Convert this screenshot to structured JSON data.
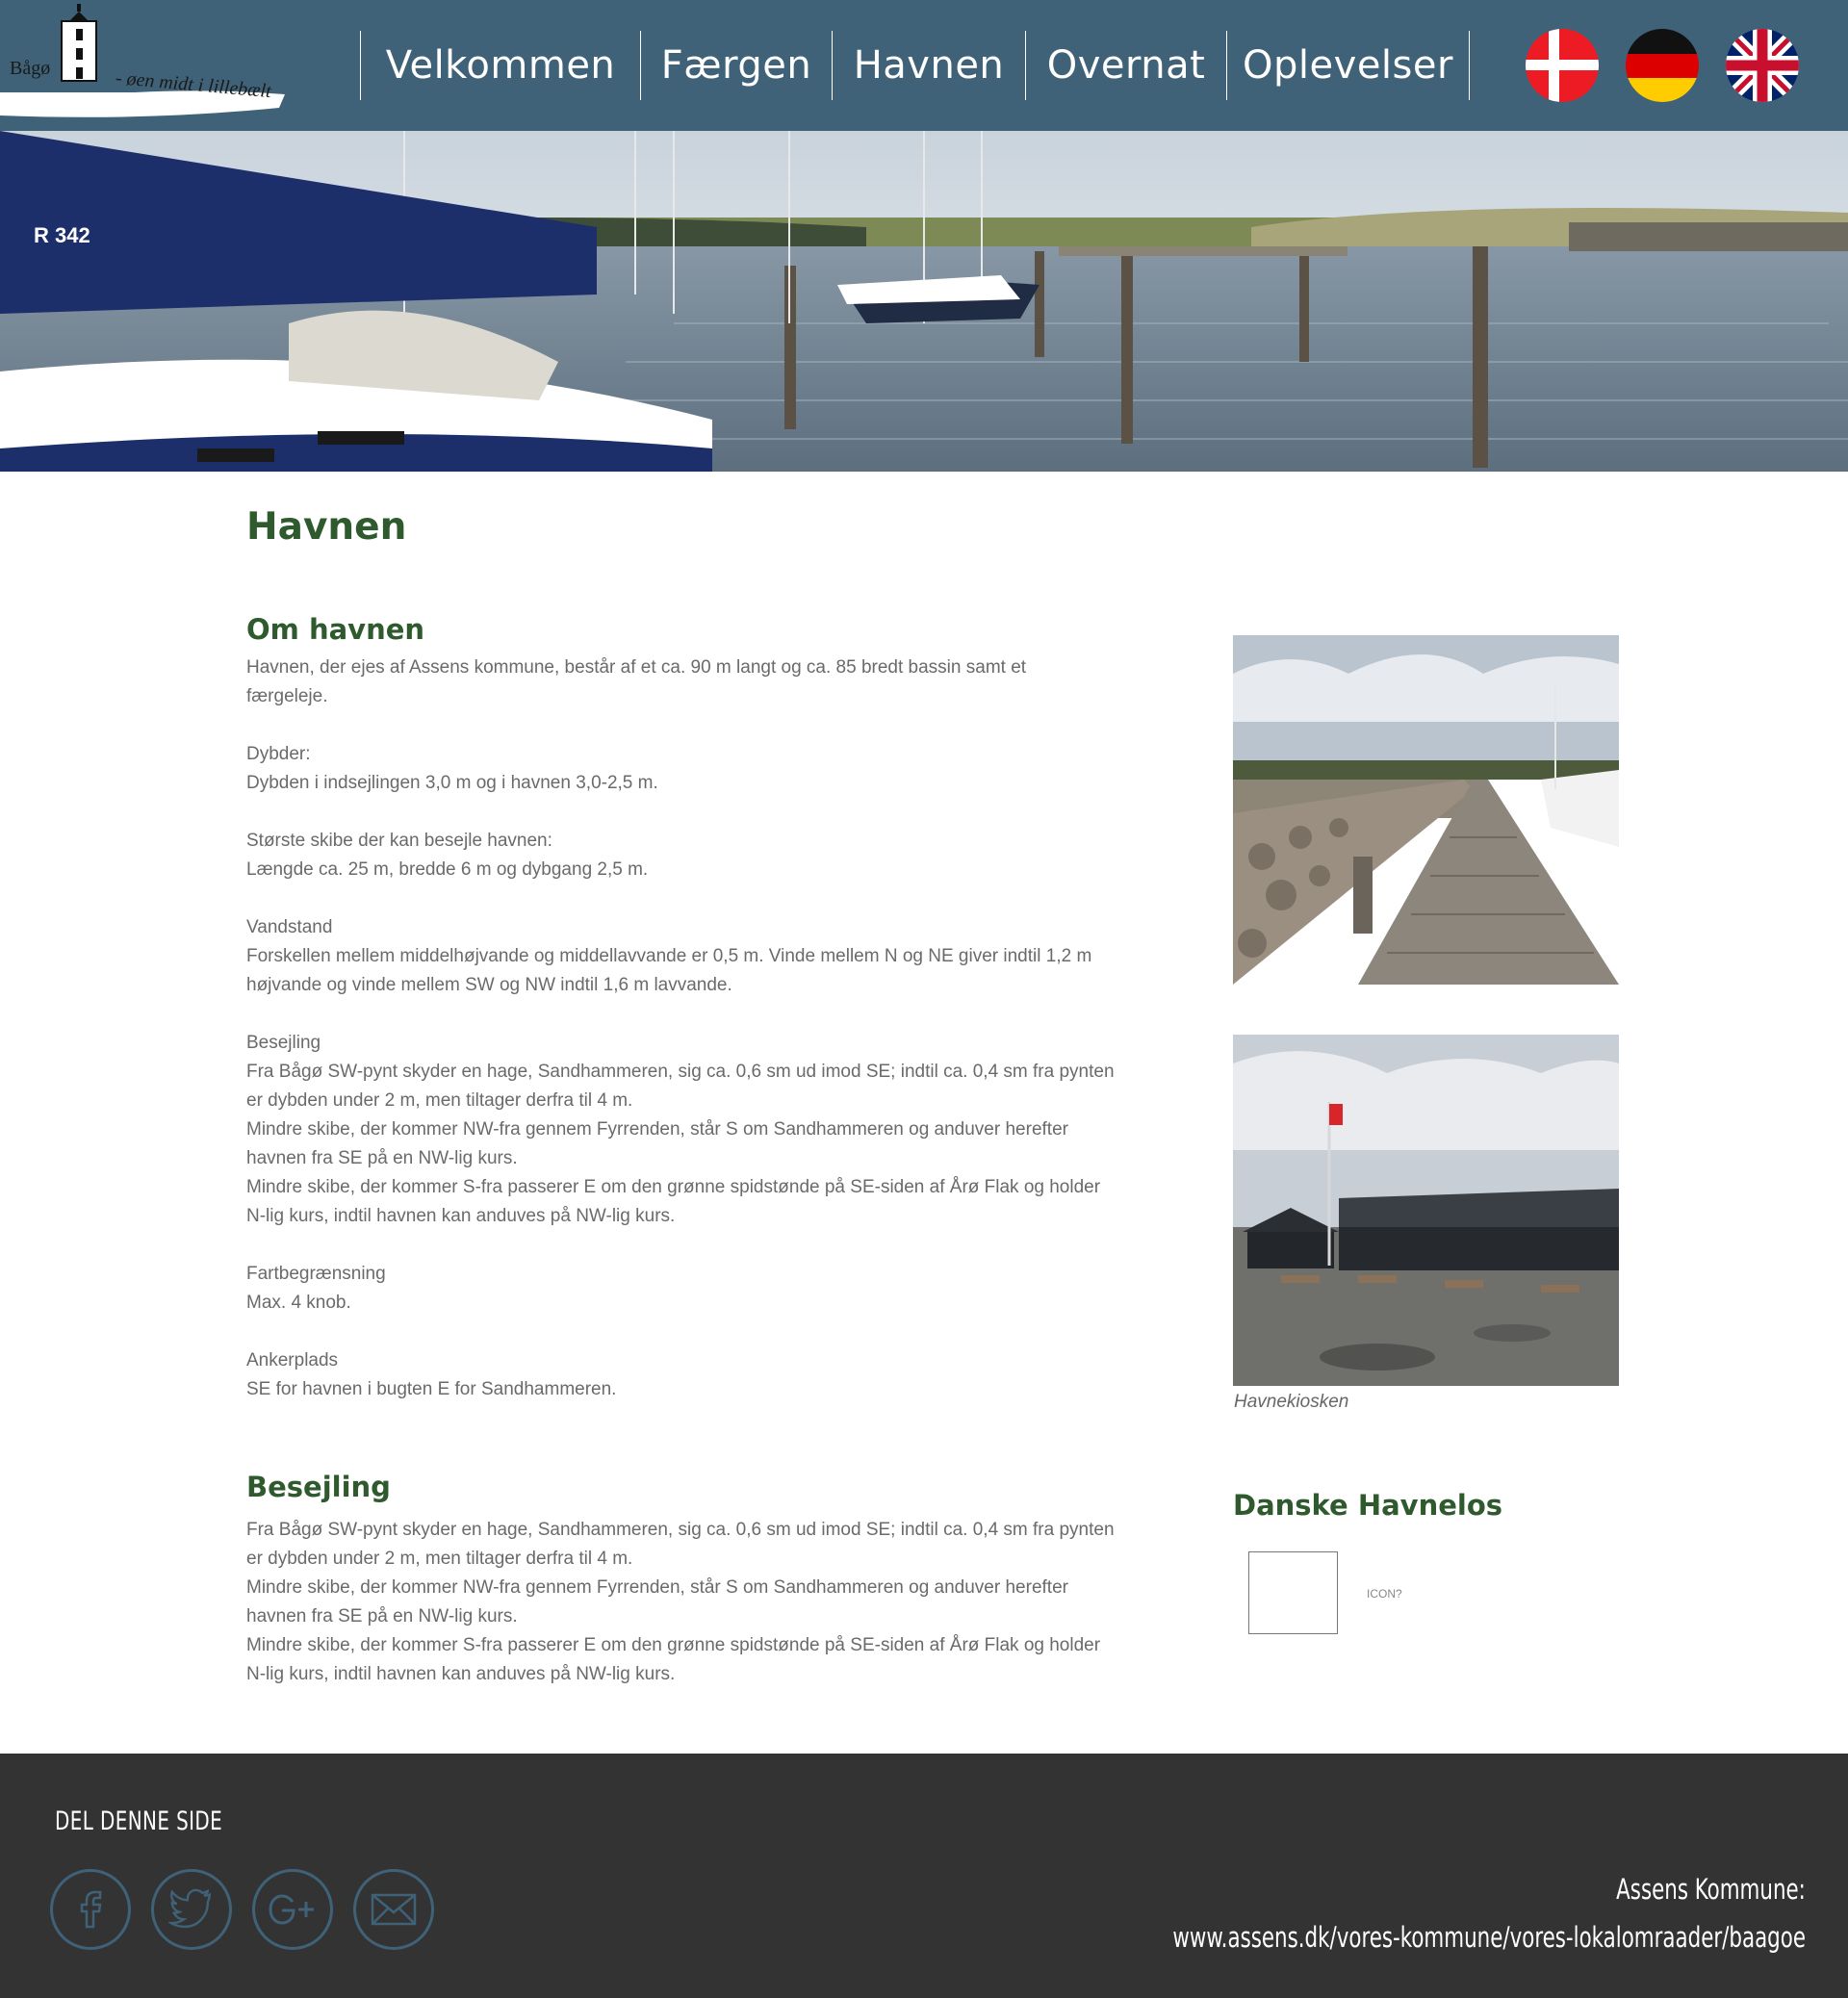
{
  "header": {
    "logo": {
      "name": "Bågø",
      "tagline": "- øen midt i lillebælt"
    },
    "nav": [
      {
        "label": "Velkommen"
      },
      {
        "label": "Færgen"
      },
      {
        "label": "Havnen"
      },
      {
        "label": "Overnat"
      },
      {
        "label": "Oplevelser"
      }
    ],
    "languages": [
      {
        "icon": "denmark-flag-icon"
      },
      {
        "icon": "germany-flag-icon"
      },
      {
        "icon": "uk-flag-icon"
      }
    ]
  },
  "main": {
    "page_title": "Havnen",
    "om_havnen": {
      "title": "Om havnen",
      "paragraphs": [
        [
          "Havnen, der ejes af Assens kommune, består af et ca. 90 m langt og ca. 85 bredt bassin samt et",
          "færgeleje."
        ],
        [
          "Dybder:",
          "Dybden i indsejlingen 3,0 m og i havnen 3,0-2,5 m."
        ],
        [
          "Største skibe der kan besejle havnen:",
          "Længde ca. 25 m, bredde 6 m og dybgang 2,5 m."
        ],
        [
          "Vandstand",
          "Forskellen mellem middelhøjvande og middellavvande er 0,5 m. Vinde mellem N og NE giver indtil 1,2 m",
          "højvande og vinde mellem SW og NW indtil 1,6 m lavvande."
        ],
        [
          "Besejling",
          "Fra Bågø SW-pynt skyder en hage, Sandhammeren, sig ca. 0,6 sm ud imod SE; indtil ca. 0,4 sm fra pynten",
          "er dybden under 2 m, men tiltager derfra til 4 m.",
          "Mindre skibe, der kommer NW-fra gennem Fyrrenden, står S om Sandhammeren og anduver herefter",
          "havnen fra SE på en NW-lig kurs.",
          "Mindre skibe, der kommer S-fra passerer E om den grønne spidstønde på SE-siden af Årø Flak og holder",
          "N-lig kurs, indtil havnen kan anduves på NW-lig kurs."
        ],
        [
          "Fartbegrænsning",
          "Max. 4 knob."
        ],
        [
          "Ankerplads",
          "SE for havnen i bugten E for Sandhammeren."
        ]
      ]
    },
    "besejling": {
      "title": "Besejling",
      "lines": [
        "Fra Bågø SW-pynt skyder en hage, Sandhammeren, sig ca. 0,6 sm ud imod SE; indtil ca. 0,4 sm fra pynten",
        "er dybden under 2 m, men tiltager derfra til 4 m.",
        "Mindre skibe, der kommer NW-fra gennem Fyrrenden, står S om Sandhammeren og anduver herefter",
        "havnen fra SE på en NW-lig kurs.",
        "Mindre skibe, der kommer S-fra passerer E om den grønne spidstønde på SE-siden af Årø Flak og holder",
        "N-lig kurs, indtil havnen kan anduves på NW-lig kurs."
      ]
    }
  },
  "sidebar": {
    "photo_caption": "Havnekiosken",
    "havnelos_title": "Danske Havnelos",
    "icon_placeholder": "ICON?"
  },
  "footer": {
    "share_title": "DEL DENNE SIDE",
    "social": [
      {
        "icon": "facebook-icon"
      },
      {
        "icon": "twitter-icon"
      },
      {
        "icon": "google-plus-icon"
      },
      {
        "icon": "email-icon"
      }
    ],
    "municipality_label": "Assens Kommune:",
    "municipality_url": "www.assens.dk/vores-kommune/vores-lokalomraader/baagoe"
  },
  "colors": {
    "header_bg": "#3f6278",
    "heading_green": "#2e5a2e",
    "body_text": "#6a6a6a",
    "footer_bg": "#333333"
  }
}
